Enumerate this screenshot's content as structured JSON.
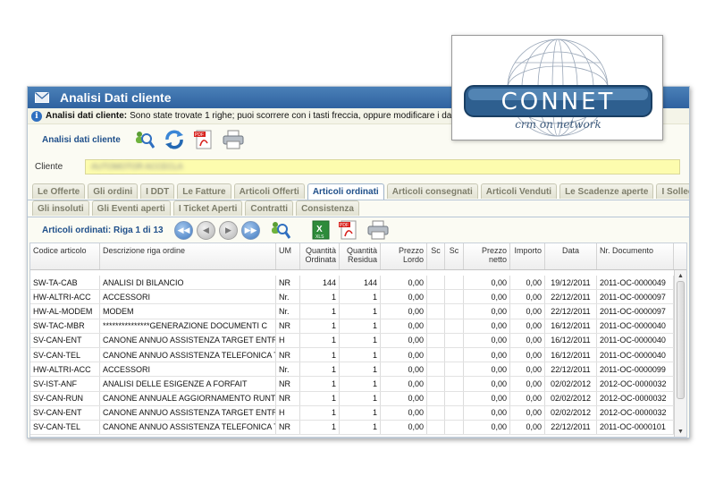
{
  "window": {
    "title": "Analisi Dati cliente"
  },
  "info": {
    "bold": "Analisi dati cliente:",
    "text": "Sono state trovate 1 righe; puoi scorrere con i tasti freccia, oppure modificare i dati"
  },
  "toolbar": {
    "label": "Analisi dati cliente",
    "icons": [
      "search-people-icon",
      "refresh-icon",
      "pdf-icon",
      "printer-icon"
    ]
  },
  "client": {
    "label": "Cliente",
    "value": "AUTOMOTOR ACCECLA"
  },
  "tabs_row1": [
    "Le Offerte",
    "Gli ordini",
    "I DDT",
    "Le Fatture",
    "Articoli Offerti",
    "Articoli ordinati",
    "Articoli consegnati",
    "Articoli Venduti",
    "Le Scadenze aperte",
    "I Solleciti"
  ],
  "tabs_row2": [
    "Gli insoluti",
    "Gli Eventi aperti",
    "I Ticket Aperti",
    "Contratti",
    "Consistenza"
  ],
  "active_tab": "Articoli ordinati",
  "nav": {
    "label": "Articoli ordinati: Riga 1 di 13",
    "buttons": [
      "first",
      "prev",
      "next",
      "last"
    ]
  },
  "grid": {
    "columns": [
      "Codice articolo",
      "Descrizione riga ordine",
      "UM",
      "Quantità Ordinata",
      "Quantità Residua",
      "Prezzo Lordo",
      "Sc",
      "Sc",
      "Prezzo netto",
      "Importo",
      "Data",
      "Nr. Documento"
    ],
    "rows": [
      [
        "SW-TA-CAB",
        "ANALISI DI BILANCIO",
        "NR",
        "144",
        "144",
        "0,00",
        "",
        "",
        "0,00",
        "0,00",
        "19/12/2011",
        "2011-OC-0000049"
      ],
      [
        "HW-ALTRI-ACC",
        "ACCESSORI",
        "Nr.",
        "1",
        "1",
        "0,00",
        "",
        "",
        "0,00",
        "0,00",
        "22/12/2011",
        "2011-OC-0000097"
      ],
      [
        "HW-AL-MODEM",
        "MODEM",
        "Nr.",
        "1",
        "1",
        "0,00",
        "",
        "",
        "0,00",
        "0,00",
        "22/12/2011",
        "2011-OC-0000097"
      ],
      [
        "SW-TAC-MBR",
        "***************GENERAZIONE DOCUMENTI C",
        "NR",
        "1",
        "1",
        "0,00",
        "",
        "",
        "0,00",
        "0,00",
        "16/12/2011",
        "2011-OC-0000040"
      ],
      [
        "SV-CAN-ENT",
        "CANONE ANNUO ASSISTENZA TARGET ENTRY",
        "H",
        "1",
        "1",
        "0,00",
        "",
        "",
        "0,00",
        "0,00",
        "16/12/2011",
        "2011-OC-0000040"
      ],
      [
        "SV-CAN-TEL",
        "CANONE ANNUO ASSISTENZA TELEFONICA TAR(",
        "NR",
        "1",
        "1",
        "0,00",
        "",
        "",
        "0,00",
        "0,00",
        "16/12/2011",
        "2011-OC-0000040"
      ],
      [
        "HW-ALTRI-ACC",
        "ACCESSORI",
        "Nr.",
        "1",
        "1",
        "0,00",
        "",
        "",
        "0,00",
        "0,00",
        "22/12/2011",
        "2011-OC-0000099"
      ],
      [
        "SV-IST-ANF",
        "ANALISI DELLE ESIGENZE A FORFAIT",
        "NR",
        "1",
        "1",
        "0,00",
        "",
        "",
        "0,00",
        "0,00",
        "02/02/2012",
        "2012-OC-0000032"
      ],
      [
        "SV-CAN-RUN",
        "CANONE ANNUALE AGGIORNAMENTO RUNTIME",
        "NR",
        "1",
        "1",
        "0,00",
        "",
        "",
        "0,00",
        "0,00",
        "02/02/2012",
        "2012-OC-0000032"
      ],
      [
        "SV-CAN-ENT",
        "CANONE ANNUO ASSISTENZA TARGET ENTRY",
        "H",
        "1",
        "1",
        "0,00",
        "",
        "",
        "0,00",
        "0,00",
        "02/02/2012",
        "2012-OC-0000032"
      ],
      [
        "SV-CAN-TEL",
        "CANONE ANNUO ASSISTENZA TELEFONICA TAR(",
        "NR",
        "1",
        "1",
        "0,00",
        "",
        "",
        "0,00",
        "0,00",
        "22/12/2011",
        "2011-OC-0000101"
      ]
    ]
  },
  "logo": {
    "brand": "CONNET",
    "tagline": "crm on network"
  },
  "colors": {
    "title_bar": "#2f62a0",
    "client_field": "#fdfcae",
    "accent": "#1f4f8a"
  }
}
